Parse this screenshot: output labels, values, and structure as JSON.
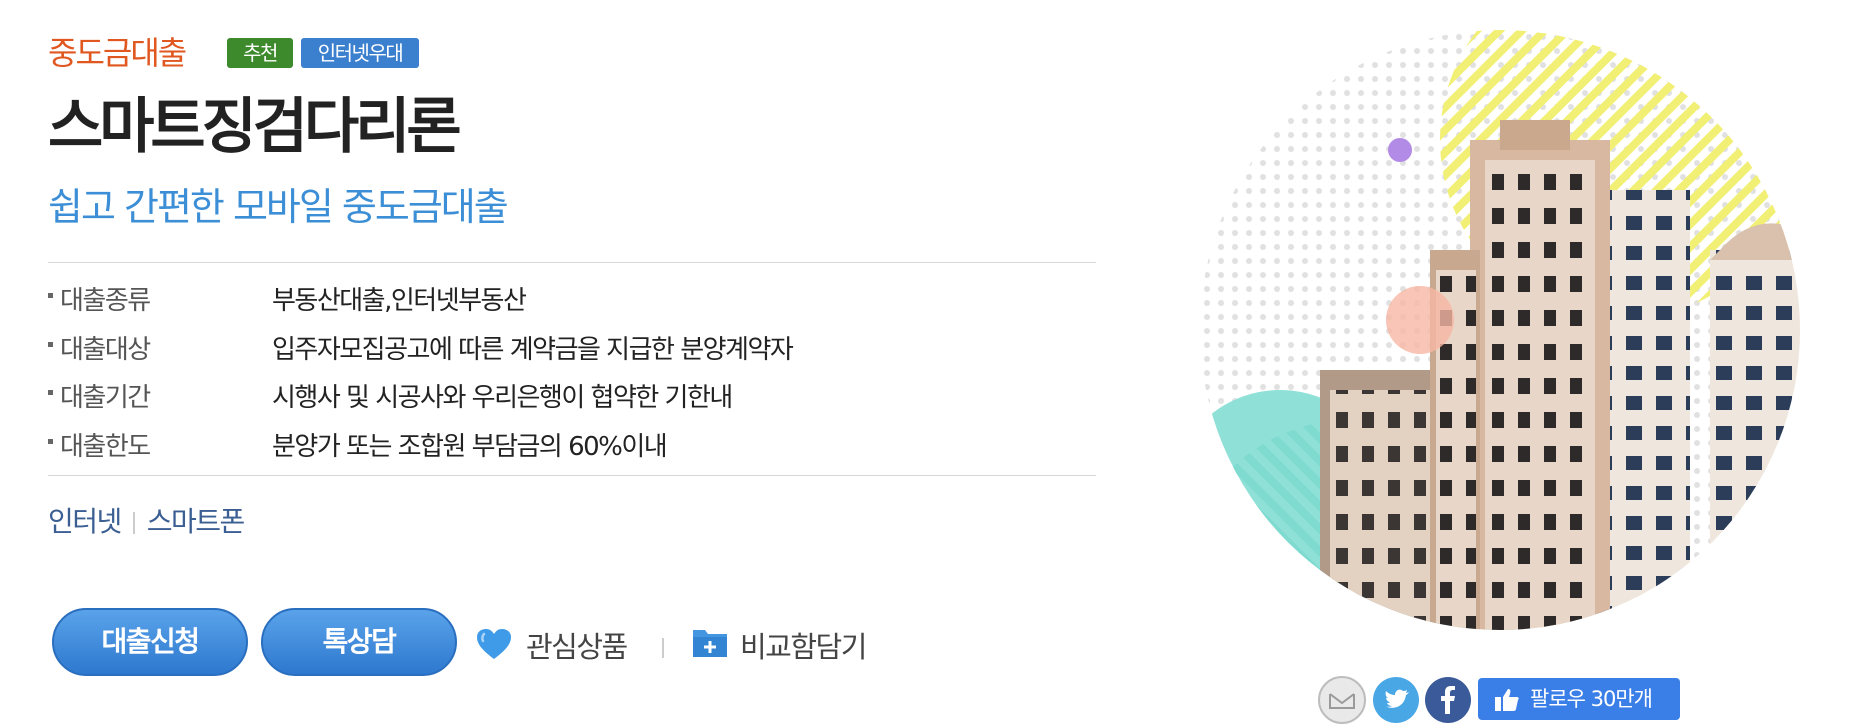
{
  "header": {
    "category": "중도금대출",
    "badges": [
      "추천",
      "인터넷우대"
    ],
    "title": "스마트징검다리론",
    "subtitle": "쉽고 간편한 모바일 중도금대출"
  },
  "info": [
    {
      "label": "대출종류",
      "value": "부동산대출,인터넷부동산"
    },
    {
      "label": "대출대상",
      "value": "입주자모집공고에 따른 계약금을 지급한 분양계약자"
    },
    {
      "label": "대출기간",
      "value": "시행사 및 시공사와 우리은행이 협약한 기한내"
    },
    {
      "label": "대출한도",
      "value": "분양가 또는 조합원 부담금의 60%이내"
    }
  ],
  "channels": [
    "인터넷",
    "스마트폰"
  ],
  "actions": {
    "apply": "대출신청",
    "chat": "톡상담",
    "interest": "관심상품",
    "compare": "비교함담기"
  },
  "social": {
    "follow_label": "팔로우 30만개",
    "icons": [
      "mail-icon",
      "twitter-icon",
      "facebook-icon",
      "thumbs-up-icon"
    ]
  },
  "colors": {
    "category": "#e0571f",
    "badge_green": "#3c8a2c",
    "badge_blue": "#3b7fcf",
    "subtitle": "#3c8fd6",
    "button": "#3a84d8",
    "follow": "#3a7ee8"
  }
}
